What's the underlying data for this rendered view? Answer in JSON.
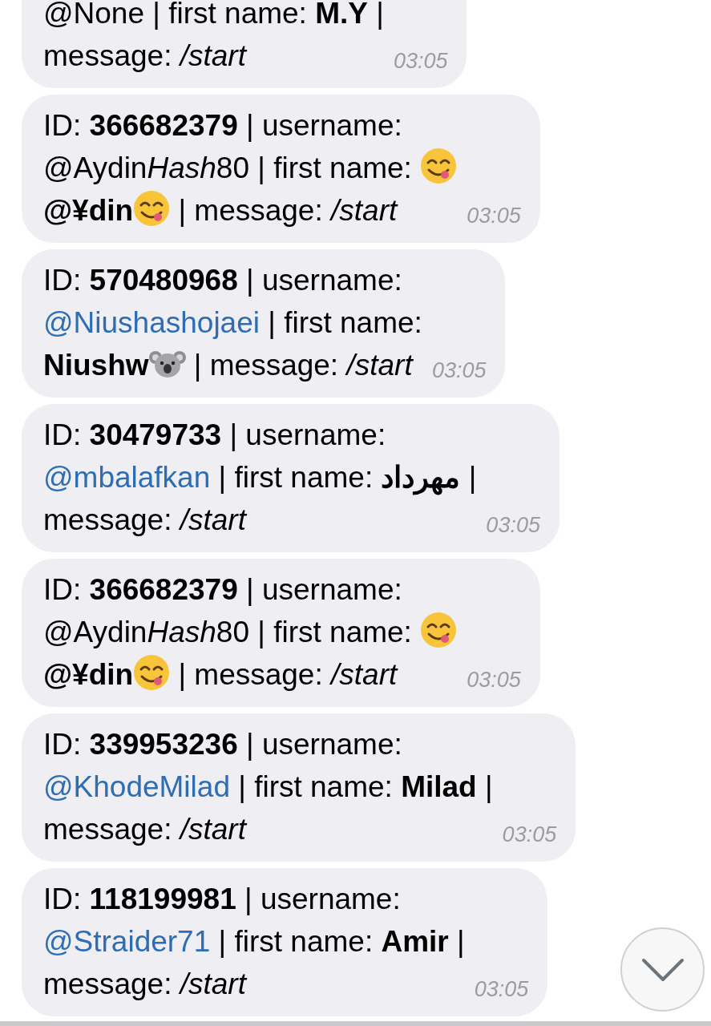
{
  "messages": [
    {
      "cut_off_top": true,
      "time": "03:05",
      "parts": [
        {
          "kind": "text",
          "text": "@None | first name: **M.Y** |"
        },
        {
          "kind": "break"
        },
        {
          "kind": "text",
          "text": "message: */start*"
        }
      ]
    },
    {
      "cut_off_top": false,
      "time": "03:05",
      "parts": [
        {
          "kind": "text",
          "text": "ID: **366682379** | username:"
        },
        {
          "kind": "break"
        },
        {
          "kind": "text",
          "text": "@Aydin"
        },
        {
          "kind": "italic",
          "text": "Hash"
        },
        {
          "kind": "text",
          "text": "80 | first name: "
        },
        {
          "kind": "emoji_face"
        },
        {
          "kind": "break"
        },
        {
          "kind": "text",
          "text": "**@¥din**"
        },
        {
          "kind": "emoji_face"
        },
        {
          "kind": "text",
          "text": " | message: */start*"
        }
      ]
    },
    {
      "cut_off_top": false,
      "time": "03:05",
      "parts": [
        {
          "kind": "text",
          "text": "ID: **570480968** | username:"
        },
        {
          "kind": "break"
        },
        {
          "kind": "link",
          "text": "@Niushashojaei"
        },
        {
          "kind": "text",
          "text": " | first name:"
        },
        {
          "kind": "break"
        },
        {
          "kind": "text",
          "text": "**Niushw**"
        },
        {
          "kind": "emoji_koala"
        },
        {
          "kind": "text",
          "text": " | message: */start*"
        }
      ]
    },
    {
      "cut_off_top": false,
      "time": "03:05",
      "parts": [
        {
          "kind": "text",
          "text": "ID: **30479733** | username:"
        },
        {
          "kind": "break"
        },
        {
          "kind": "link",
          "text": "@mbalafkan"
        },
        {
          "kind": "text",
          "text": " | first name: **‏مهرداد‏** |"
        },
        {
          "kind": "break"
        },
        {
          "kind": "text",
          "text": "message: */start*"
        }
      ]
    },
    {
      "cut_off_top": false,
      "time": "03:05",
      "parts": [
        {
          "kind": "text",
          "text": "ID: **366682379** | username:"
        },
        {
          "kind": "break"
        },
        {
          "kind": "text",
          "text": "@Aydin"
        },
        {
          "kind": "italic",
          "text": "Hash"
        },
        {
          "kind": "text",
          "text": "80 | first name: "
        },
        {
          "kind": "emoji_face"
        },
        {
          "kind": "break"
        },
        {
          "kind": "text",
          "text": "**@¥din**"
        },
        {
          "kind": "emoji_face"
        },
        {
          "kind": "text",
          "text": " | message: */start*"
        }
      ]
    },
    {
      "cut_off_top": false,
      "time": "03:05",
      "parts": [
        {
          "kind": "text",
          "text": "ID: **339953236** | username:"
        },
        {
          "kind": "break"
        },
        {
          "kind": "link",
          "text": "@KhodeMilad"
        },
        {
          "kind": "text",
          "text": " | first name: **Milad** |"
        },
        {
          "kind": "break"
        },
        {
          "kind": "text",
          "text": "message: */start*"
        }
      ]
    },
    {
      "cut_off_top": false,
      "time": "03:05",
      "parts": [
        {
          "kind": "text",
          "text": "ID: **118199981** | username:"
        },
        {
          "kind": "break"
        },
        {
          "kind": "link",
          "text": "@Straider71"
        },
        {
          "kind": "text",
          "text": " | first name: **Amir** |"
        },
        {
          "kind": "break"
        },
        {
          "kind": "text",
          "text": "message: */start*"
        }
      ]
    }
  ]
}
